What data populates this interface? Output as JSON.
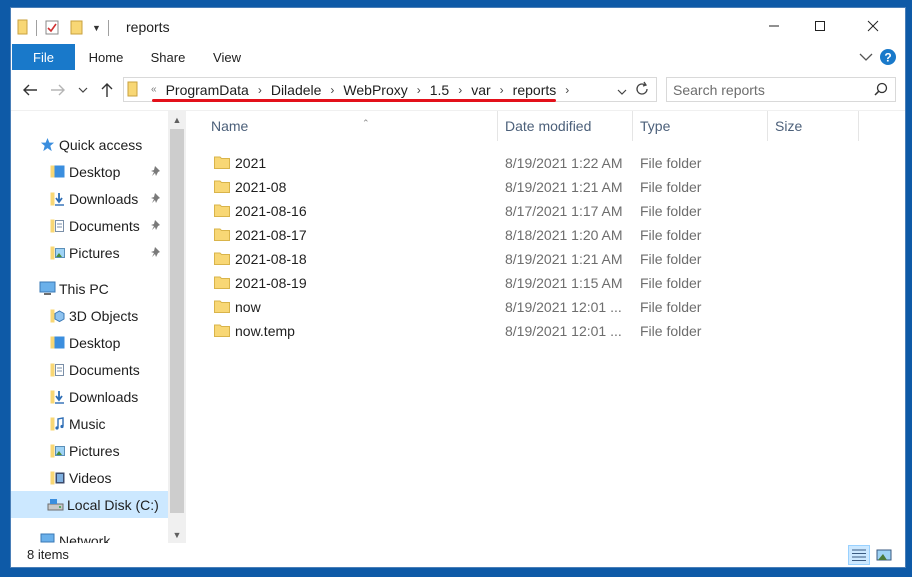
{
  "window": {
    "title": "reports",
    "controls": {
      "minimize": "—",
      "maximize": "☐",
      "close": "✕"
    }
  },
  "ribbon": {
    "tabs": [
      "File",
      "Home",
      "Share",
      "View"
    ]
  },
  "address": {
    "overflow": "«",
    "crumbs": [
      "ProgramData",
      "Diladele",
      "WebProxy",
      "1.5",
      "var",
      "reports"
    ],
    "search_placeholder": "Search reports"
  },
  "nav": {
    "quick_access": "Quick access",
    "quick_items": [
      "Desktop",
      "Downloads",
      "Documents",
      "Pictures"
    ],
    "this_pc": "This PC",
    "pc_items": [
      "3D Objects",
      "Desktop",
      "Documents",
      "Downloads",
      "Music",
      "Pictures",
      "Videos",
      "Local Disk (C:)"
    ],
    "network": "Network"
  },
  "columns": [
    "Name",
    "Date modified",
    "Type",
    "Size"
  ],
  "files": [
    {
      "name": "2021",
      "date": "8/19/2021 1:22 AM",
      "type": "File folder"
    },
    {
      "name": "2021-08",
      "date": "8/19/2021 1:21 AM",
      "type": "File folder"
    },
    {
      "name": "2021-08-16",
      "date": "8/17/2021 1:17 AM",
      "type": "File folder"
    },
    {
      "name": "2021-08-17",
      "date": "8/18/2021 1:20 AM",
      "type": "File folder"
    },
    {
      "name": "2021-08-18",
      "date": "8/19/2021 1:21 AM",
      "type": "File folder"
    },
    {
      "name": "2021-08-19",
      "date": "8/19/2021 1:15 AM",
      "type": "File folder"
    },
    {
      "name": "now",
      "date": "8/19/2021 12:01 ...",
      "type": "File folder"
    },
    {
      "name": "now.temp",
      "date": "8/19/2021 12:01 ...",
      "type": "File folder"
    }
  ],
  "status": {
    "item_count": "8 items"
  },
  "colors": {
    "accent": "#1979ca",
    "folder": "#f8d775",
    "selection": "#cce8ff",
    "underline": "#e3101a"
  }
}
